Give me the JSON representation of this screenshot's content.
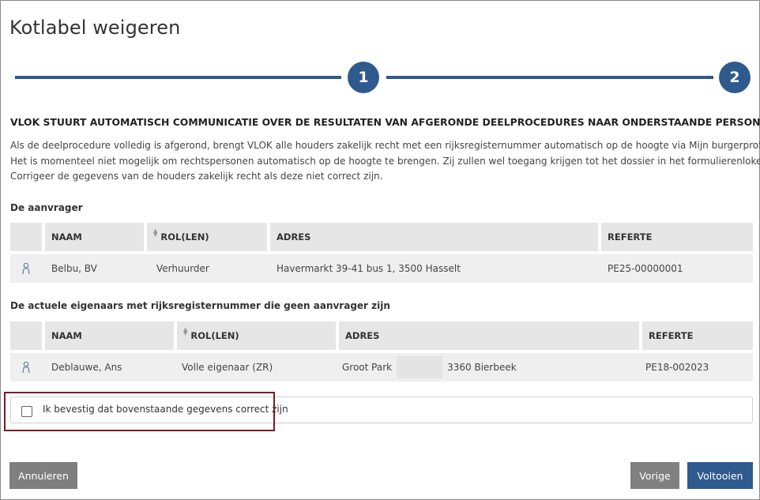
{
  "dialog": {
    "title": "Kotlabel weigeren",
    "steps": [
      "1",
      "2"
    ]
  },
  "info": {
    "heading": "VLOK STUURT AUTOMATISCH COMMUNICATIE OVER DE RESULTATEN VAN AFGERONDE DEELPROCEDURES NAAR ONDERSTAANDE PERSONEN",
    "lines": [
      "Als de deelprocedure volledig is afgerond, brengt VLOK alle houders zakelijk recht met een rijksregisternummer automatisch op de hoogte via Mijn burgerprofiel.",
      "Het is momenteel niet mogelijk om rechtspersonen automatisch op de hoogte te brengen. Zij zullen wel toegang krijgen tot het dossier in het formulierenloket.",
      "Corrigeer de gegevens van de houders zakelijk recht als deze niet correct zijn."
    ]
  },
  "applicant": {
    "label": "De aanvrager",
    "columns": [
      "NAAM",
      "ROL(LEN)",
      "ADRES",
      "REFERTE"
    ],
    "rows": [
      {
        "icon": "person-icon",
        "name": "Belbu, BV",
        "role": "Verhuurder",
        "address": "Havermarkt 39-41 bus 1, 3500 Hasselt",
        "reference": "PE25-00000001"
      }
    ]
  },
  "owners": {
    "label": "De actuele eigenaars met rijksregisternummer die geen aanvrager zijn",
    "columns": [
      "NAAM",
      "ROL(LEN)",
      "ADRES",
      "REFERTE"
    ],
    "rows": [
      {
        "icon": "person-icon",
        "name": "Deblauwe, Ans",
        "role": "Volle eigenaar (ZR)",
        "address_start": "Groot Park",
        "address_end": "3360 Bierbeek",
        "reference": "PE18-002023"
      }
    ]
  },
  "confirmation": {
    "label": "Ik bevestig dat bovenstaande gegevens correct zijn",
    "checked": false
  },
  "buttons": {
    "cancel": "Annuleren",
    "previous": "Vorige",
    "finish": "Voltooien"
  },
  "colors": {
    "primary": "#2f5a8e",
    "secondary_button": "#808080",
    "highlight_border": "#7b1b24"
  }
}
